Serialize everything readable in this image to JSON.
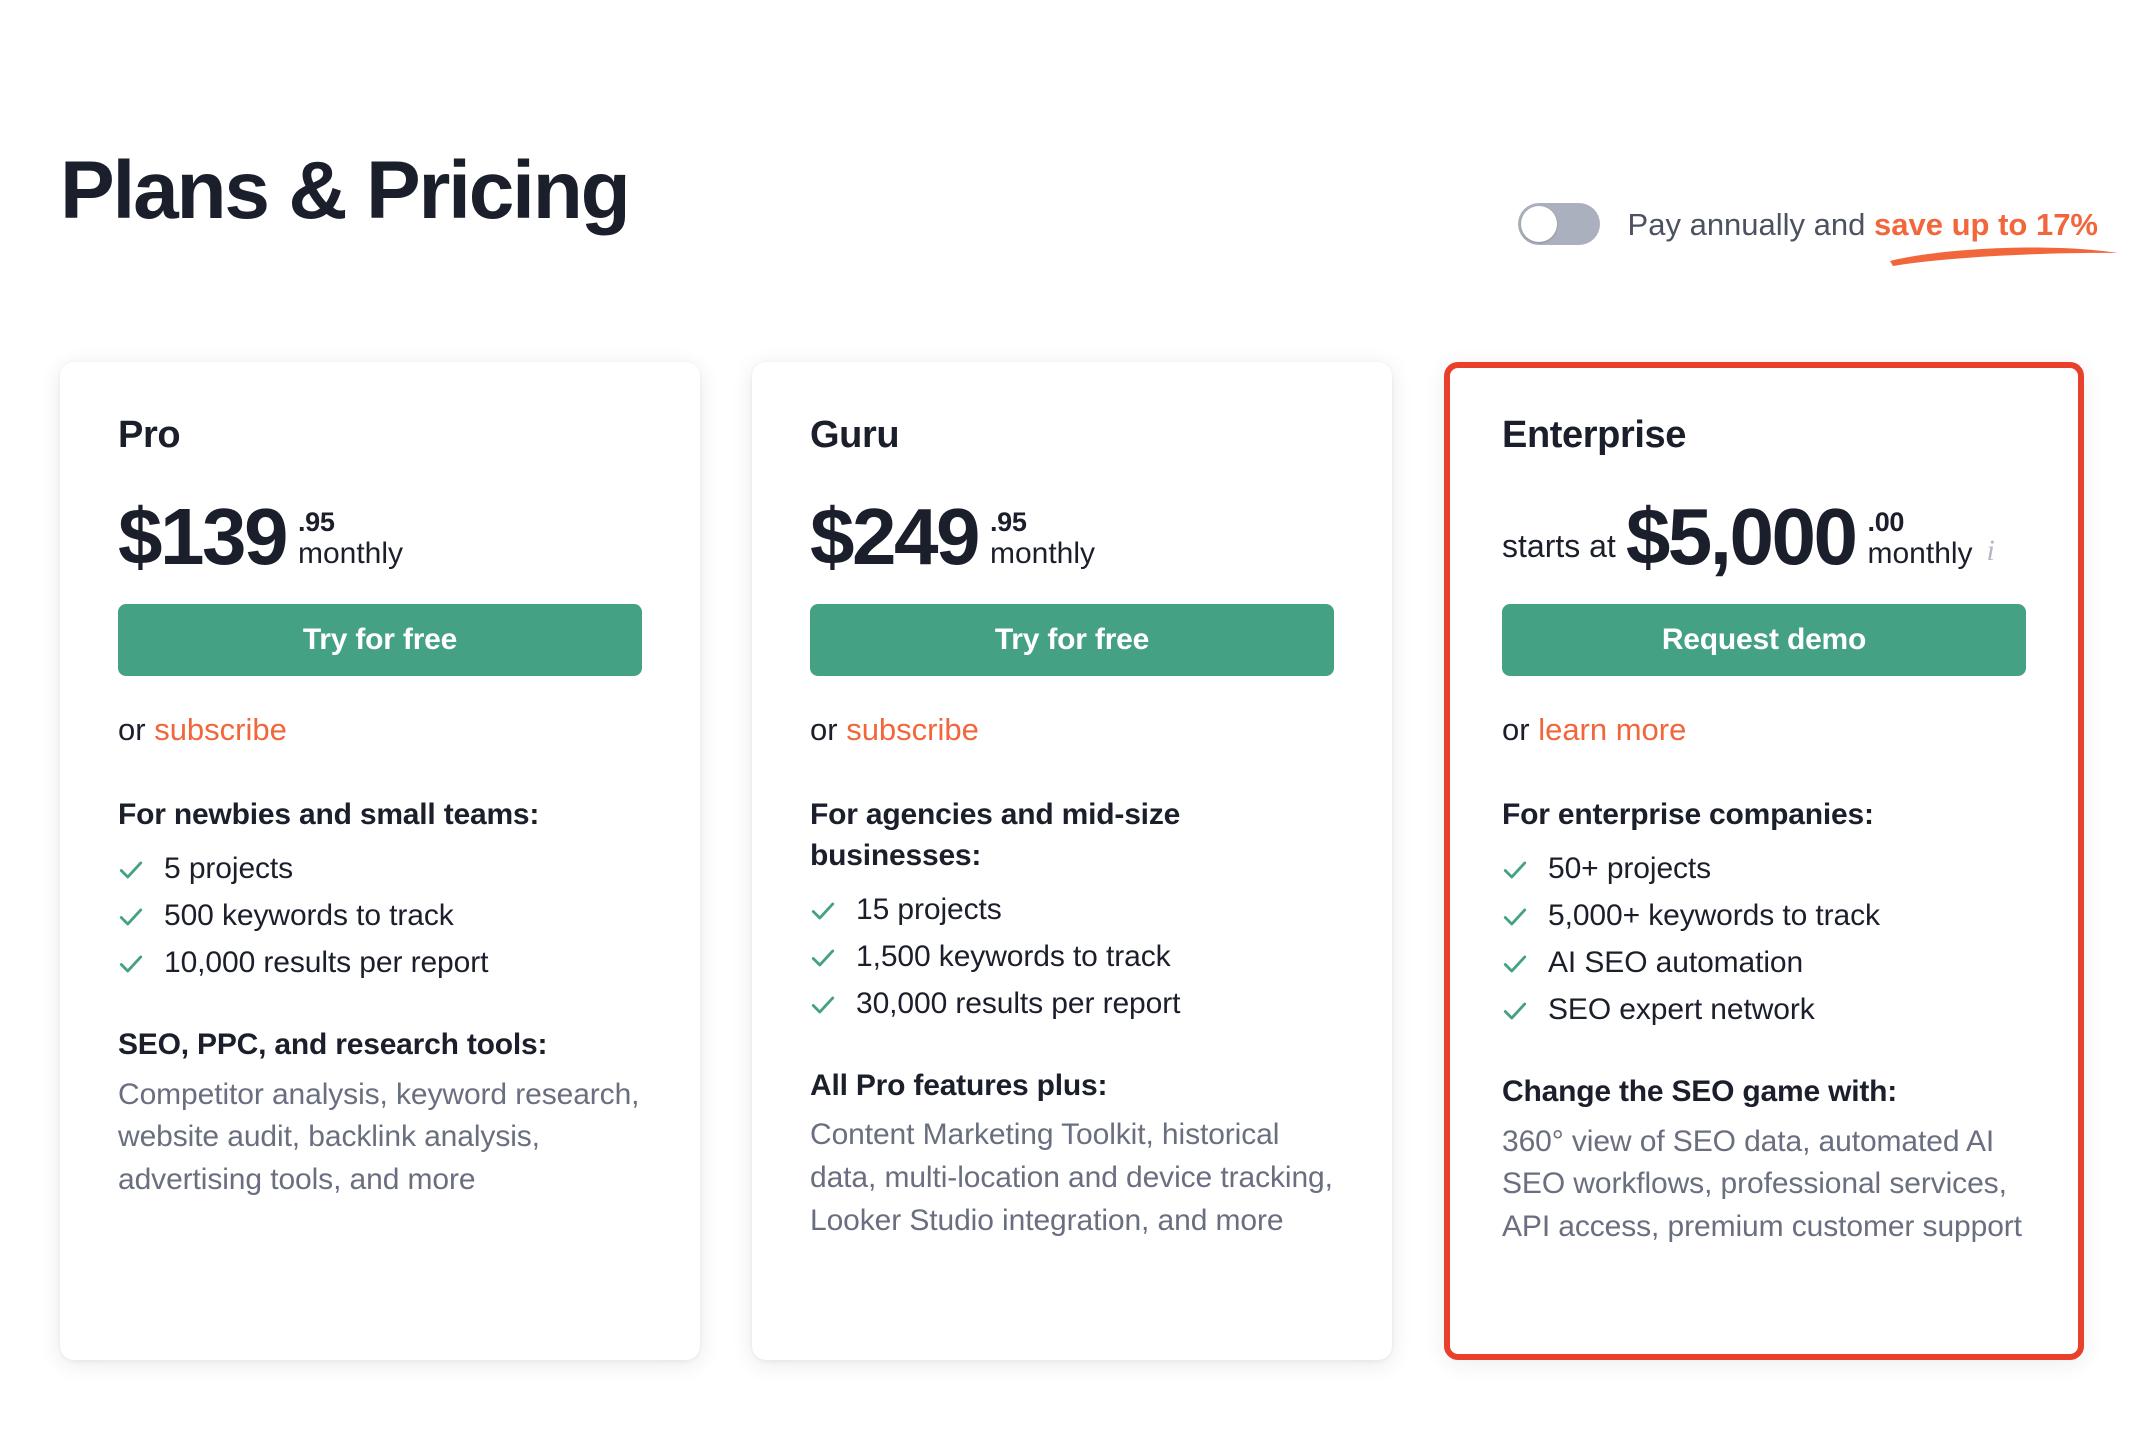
{
  "header": {
    "title": "Plans & Pricing",
    "billing": {
      "toggle_state": "off",
      "toggle_name": "pay-annually-toggle",
      "text_prefix": "Pay annually and ",
      "text_highlight": "save up to 17%"
    }
  },
  "colors": {
    "accent_orange": "#f2663b",
    "highlight_border": "#e8402a",
    "cta_green": "#45a184",
    "check_green": "#45a184",
    "text_dark": "#1b1f2b",
    "text_muted": "#6a6f80",
    "toggle_track": "#aab0bd"
  },
  "plans": [
    {
      "id": "pro",
      "name": "Pro",
      "price_prefix": "",
      "price_main": "$139",
      "price_cents": ".95",
      "price_period": "monthly",
      "has_info_icon": false,
      "cta_label": "Try for free",
      "alt_prefix": "or ",
      "alt_link": "subscribe",
      "features_head": "For newbies and small teams:",
      "features": [
        "5 projects",
        "500 keywords to track",
        "10,000 results per report"
      ],
      "desc_head": "SEO, PPC, and research tools:",
      "desc_body": "Competitor analysis, keyword research, website audit, backlink analysis, advertising tools, and more"
    },
    {
      "id": "guru",
      "name": "Guru",
      "price_prefix": "",
      "price_main": "$249",
      "price_cents": ".95",
      "price_period": "monthly",
      "has_info_icon": false,
      "cta_label": "Try for free",
      "alt_prefix": "or ",
      "alt_link": "subscribe",
      "features_head": "For agencies and mid-size businesses:",
      "features": [
        "15 projects",
        "1,500 keywords to track",
        "30,000 results per report"
      ],
      "desc_head": "All Pro features plus:",
      "desc_body": "Content Marketing Toolkit, historical data, multi-location and device tracking, Looker Studio integration, and more"
    },
    {
      "id": "enterprise",
      "name": "Enterprise",
      "price_prefix": "starts at",
      "price_main": "$5,000",
      "price_cents": ".00",
      "price_period": "monthly",
      "has_info_icon": true,
      "info_icon_glyph": "i",
      "cta_label": "Request demo",
      "alt_prefix": "or ",
      "alt_link": "learn more",
      "features_head": "For enterprise companies:",
      "features": [
        "50+ projects",
        "5,000+ keywords to track",
        "AI SEO automation",
        "SEO expert network"
      ],
      "desc_head": "Change the SEO game with:",
      "desc_body": "360° view of SEO data, automated AI SEO workflows, professional services, API access, premium customer support"
    }
  ]
}
